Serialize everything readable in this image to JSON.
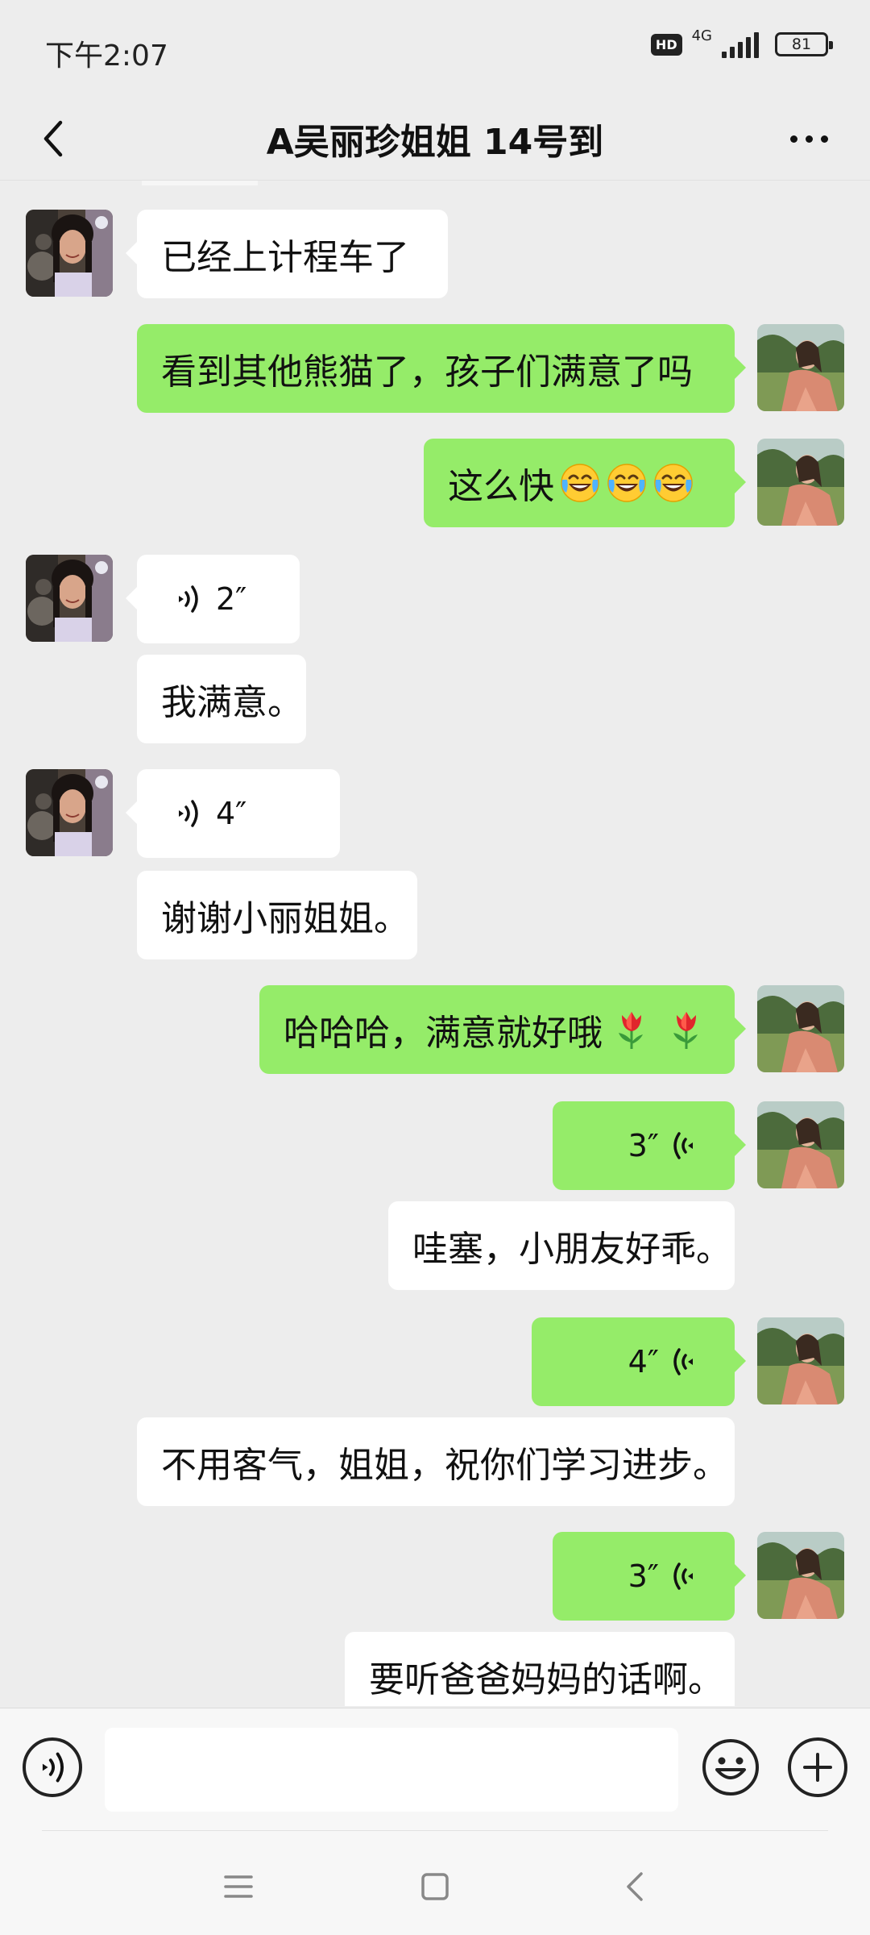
{
  "status_bar": {
    "time": "下午2:07",
    "hd": "HD",
    "network": "4G",
    "battery": "81"
  },
  "header": {
    "title": "A吴丽珍姐姐 14号到",
    "back_icon": "chevron-left-icon",
    "more_icon": "more-dots-icon"
  },
  "colors": {
    "background": "#ededed",
    "incoming_bubble": "#ffffff",
    "outgoing_bubble": "#95ec69"
  },
  "messages": [
    {
      "side": "in",
      "type": "text",
      "text": "已经上计程车了"
    },
    {
      "side": "out",
      "type": "text",
      "text": "看到其他熊猫了，孩子们满意了吗"
    },
    {
      "side": "out",
      "type": "text",
      "text": "这么快",
      "emoji": [
        "face-with-tears-of-joy",
        "face-with-tears-of-joy",
        "face-with-tears-of-joy"
      ]
    },
    {
      "side": "in",
      "type": "voice",
      "duration": "2″"
    },
    {
      "side": "in",
      "type": "text",
      "text": "我满意。"
    },
    {
      "side": "in",
      "type": "voice",
      "duration": "4″"
    },
    {
      "side": "in",
      "type": "text",
      "text": "谢谢小丽姐姐。"
    },
    {
      "side": "out",
      "type": "text",
      "text": "哈哈哈，满意就好哦",
      "emoji": [
        "tulip",
        "tulip"
      ]
    },
    {
      "side": "out",
      "type": "voice",
      "duration": "3″"
    },
    {
      "side": "in",
      "type": "text",
      "text": "哇塞，小朋友好乖。"
    },
    {
      "side": "out",
      "type": "voice",
      "duration": "4″"
    },
    {
      "side": "in",
      "type": "text",
      "text": "不用客气，姐姐，祝你们学习进步。"
    },
    {
      "side": "out",
      "type": "voice",
      "duration": "3″"
    },
    {
      "side": "in",
      "type": "text",
      "text": "要听爸爸妈妈的话啊。"
    }
  ],
  "input_bar": {
    "placeholder": "",
    "value": "",
    "voice_icon": "voice-input-icon",
    "emoji_icon": "smiley-icon",
    "plus_icon": "plus-icon"
  },
  "nav_bar": {
    "menu_icon": "menu-icon",
    "home_icon": "home-square-icon",
    "back_icon": "back-arrow-icon"
  }
}
